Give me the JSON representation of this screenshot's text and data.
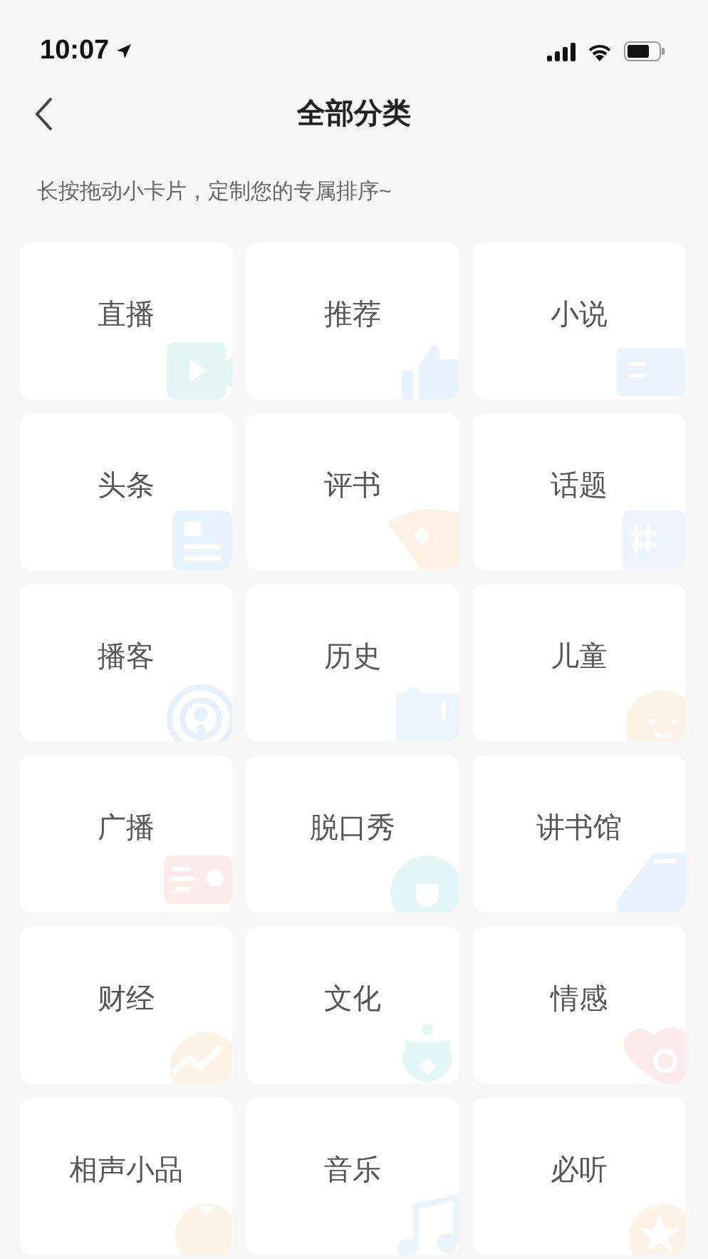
{
  "status_bar": {
    "time": "10:07"
  },
  "header": {
    "title": "全部分类"
  },
  "hint": "长按拖动小卡片，定制您的专属排序~",
  "categories": [
    {
      "label": "直播"
    },
    {
      "label": "推荐"
    },
    {
      "label": "小说"
    },
    {
      "label": "头条"
    },
    {
      "label": "评书"
    },
    {
      "label": "话题"
    },
    {
      "label": "播客"
    },
    {
      "label": "历史"
    },
    {
      "label": "儿童"
    },
    {
      "label": "广播"
    },
    {
      "label": "脱口秀"
    },
    {
      "label": "讲书馆"
    },
    {
      "label": "财经"
    },
    {
      "label": "文化"
    },
    {
      "label": "情感"
    },
    {
      "label": "相声小品"
    },
    {
      "label": "音乐"
    },
    {
      "label": "必听"
    }
  ]
}
